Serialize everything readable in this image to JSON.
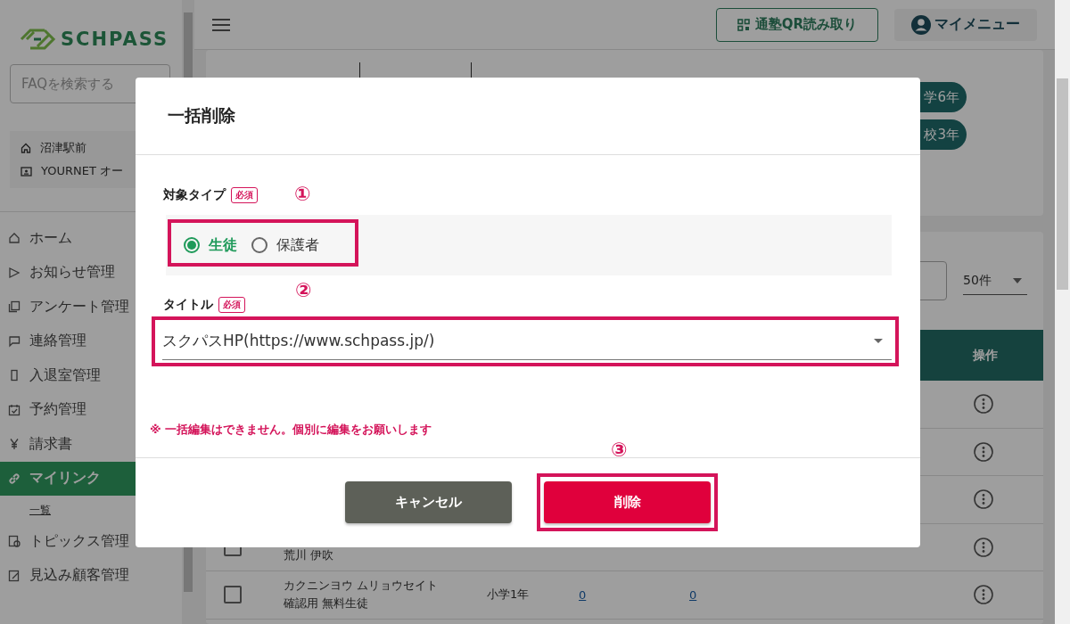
{
  "sidebar": {
    "logo": "SCHPASS",
    "search": {
      "placeholder": "FAQを検索する"
    },
    "school": "沼津駅前",
    "account": "YOURNET オー",
    "nav": [
      {
        "label": "ホーム",
        "selected": false
      },
      {
        "label": "お知らせ管理",
        "selected": false
      },
      {
        "label": "アンケート管理",
        "selected": false
      },
      {
        "label": "連絡管理",
        "selected": false
      },
      {
        "label": "入退室管理",
        "selected": false
      },
      {
        "label": "予約管理",
        "selected": false
      },
      {
        "label": "請求書",
        "selected": false
      },
      {
        "label": "マイリンク",
        "selected": true,
        "expanded": true,
        "children": [
          {
            "label": "一覧"
          }
        ]
      },
      {
        "label": "トピックス管理",
        "selected": false
      },
      {
        "label": "見込み顧客管理",
        "selected": false
      }
    ]
  },
  "header": {
    "qr_button": "通塾QR読み取り",
    "menu_button": "マイメニュー"
  },
  "content": {
    "grade_tags": [
      "学6年",
      "校3年"
    ],
    "per_page": "50件",
    "table": {
      "columns": [
        "操作"
      ],
      "rows": [
        {},
        {},
        {},
        {
          "checked": false,
          "name": "荒川 伊吹"
        },
        {
          "checked": false,
          "kana": "カクニンヨウ ムリョウセイト",
          "name": "確認用 無料生徒",
          "grade": "小学1年",
          "count_1": "0",
          "count_2": "0"
        }
      ]
    }
  },
  "dialog": {
    "title": "一括削除",
    "target_type": {
      "label": "対象タイプ",
      "required": "必須",
      "options": [
        {
          "label": "生徒",
          "selected": true
        },
        {
          "label": "保護者",
          "selected": false
        }
      ]
    },
    "title_field": {
      "label": "タイトル",
      "required": "必須",
      "value": "スクパスHP(https://www.schpass.jp/)"
    },
    "note": "※ 一括編集はできません。個別に編集をお願いします",
    "buttons": [
      {
        "label": "キャンセル",
        "kind": "secondary"
      },
      {
        "label": "削除",
        "kind": "danger"
      }
    ]
  },
  "annotations": [
    {
      "label": "①"
    },
    {
      "label": "②"
    },
    {
      "label": "③"
    }
  ]
}
